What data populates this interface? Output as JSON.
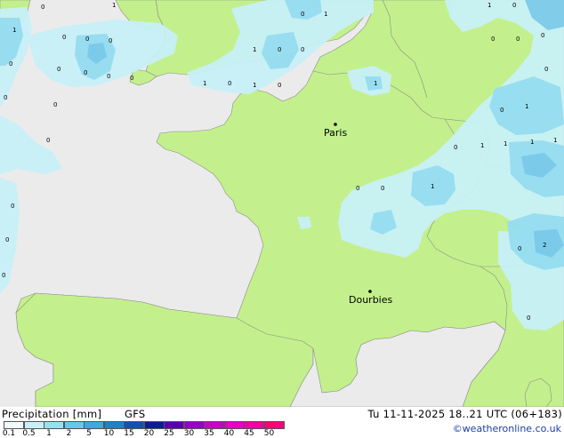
{
  "map": {
    "city_labels": [
      {
        "name": "Paris"
      },
      {
        "name": "Dourbies"
      }
    ],
    "precip_values": [
      "1",
      "0",
      "0",
      "0",
      "0",
      "0",
      "0",
      "0",
      "0",
      "0",
      "0",
      "0",
      "0",
      "0",
      "0",
      "0",
      "1",
      "0",
      "1",
      "1",
      "0",
      "0",
      "1",
      "0",
      "1",
      "0",
      "1",
      "1",
      "0",
      "0",
      "0",
      "0",
      "0",
      "1",
      "0",
      "1",
      "1",
      "1",
      "1",
      "0",
      "0",
      "0",
      "1",
      "2",
      "0",
      "0"
    ],
    "colors": {
      "land": "#c3f08c",
      "sea": "#ebebeb",
      "precip_light": "#c8f0f8",
      "precip_medium": "#96dcf0",
      "precip_heavy": "#78c8e8"
    }
  },
  "legend": {
    "title": "Precipitation [mm]",
    "model": "GFS",
    "ticks": [
      "0.1",
      "0.5",
      "1",
      "2",
      "5",
      "10",
      "15",
      "20",
      "25",
      "30",
      "35",
      "40",
      "45",
      "50"
    ],
    "colors": [
      "#f0fcfc",
      "#c8f0f8",
      "#96e1f0",
      "#64c8e6",
      "#3caadc",
      "#1e82c8",
      "#1450b4",
      "#0a1e96",
      "#5a00b4",
      "#9600c8",
      "#c800c8",
      "#e600c8",
      "#f000a0",
      "#ff0078"
    ]
  },
  "valid_time": "Tu 11-11-2025 18..21 UTC (06+183)",
  "credit": "©weatheronline.co.uk"
}
